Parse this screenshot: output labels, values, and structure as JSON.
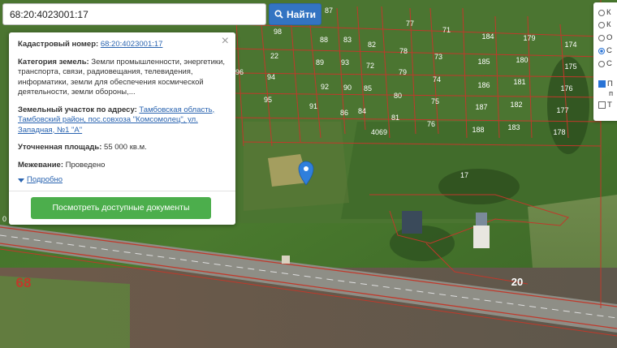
{
  "search": {
    "value": "68:20:4023001:17",
    "button_label": "Найти"
  },
  "popup": {
    "cad_label": "Кадастровый номер:",
    "cad_value": "68:20:4023001:17",
    "cat_label": "Категория земель:",
    "cat_value": "Земли промышленности, энергетики, транспорта, связи, радиовещания, телевидения, информатики, земли для обеспечения космической деятельности, земли обороны,...",
    "addr_label": "Земельный участок по адресу:",
    "addr_value": "Тамбовская область, Тамбовский район, пос.совхоза \"Комсомолец\", ул. Западная, №1 \"А\"",
    "area_label": "Уточненная площадь:",
    "area_value": "55 000 кв.м.",
    "survey_label": "Межевание:",
    "survey_value": "Проведено",
    "details_link": "Подробно",
    "docs_button": "Посмотреть доступные документы"
  },
  "layers": [
    {
      "label": "К",
      "type": "radio",
      "checked": false
    },
    {
      "label": "К",
      "type": "radio",
      "checked": false
    },
    {
      "label": "О",
      "type": "radio",
      "checked": false
    },
    {
      "label": "С",
      "type": "radio",
      "checked": true
    },
    {
      "label": "С",
      "type": "radio",
      "checked": false
    },
    {
      "label": "П",
      "type": "check",
      "checked": true
    },
    {
      "label": "п",
      "type": "text",
      "checked": false
    },
    {
      "label": "Т",
      "type": "check",
      "checked": false
    }
  ],
  "map": {
    "parcels": [
      "98",
      "88",
      "87",
      "83",
      "89",
      "93",
      "90",
      "22",
      "96",
      "94",
      "92",
      "85",
      "91",
      "95",
      "86",
      "79",
      "78",
      "77",
      "73",
      "71",
      "76",
      "79",
      "75",
      "81",
      "74",
      "80",
      "84",
      "72",
      "82",
      "184",
      "179",
      "174",
      "185",
      "180",
      "175",
      "186",
      "181",
      "176",
      "187",
      "182",
      "177",
      "188",
      "183",
      "178",
      "4069",
      "17",
      "20",
      "68",
      "0"
    ],
    "highway_color": "#c0392b",
    "parcel_color": "#c0392b"
  }
}
